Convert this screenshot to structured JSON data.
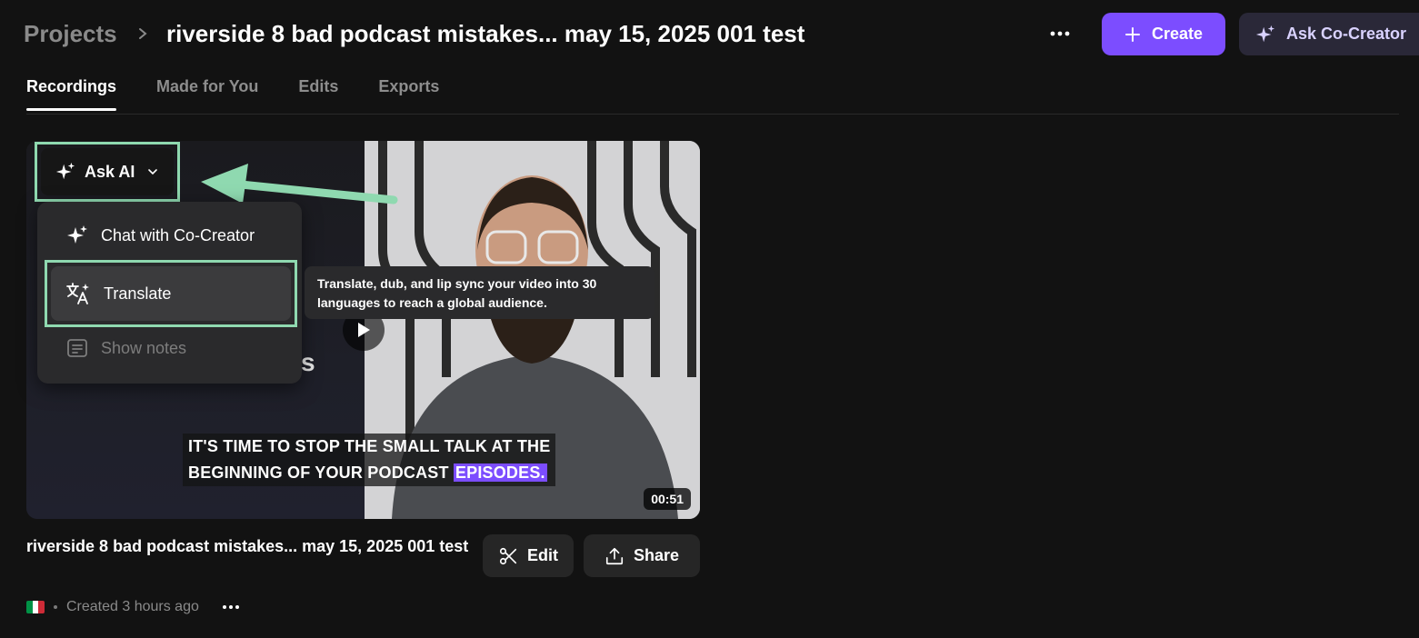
{
  "header": {
    "breadcrumb_root": "Projects",
    "project_title": "riverside 8 bad podcast mistakes... may 15, 2025 001 test",
    "create_label": "Create",
    "cocreator_label": "Ask Co-Creator"
  },
  "tabs": [
    {
      "label": "Recordings",
      "active": true
    },
    {
      "label": "Made for You",
      "active": false
    },
    {
      "label": "Edits",
      "active": false
    },
    {
      "label": "Exports",
      "active": false
    }
  ],
  "ask_ai": {
    "label": "Ask AI",
    "menu": [
      {
        "label": "Chat with Co-Creator",
        "icon": "sparkle-icon",
        "enabled": true
      },
      {
        "label": "Translate",
        "icon": "translate-icon",
        "enabled": true,
        "highlighted": true
      },
      {
        "label": "Show notes",
        "icon": "notes-icon",
        "enabled": false
      }
    ],
    "tooltip": "Translate, dub, and lip sync your video into 30 languages to reach a global audience."
  },
  "recording": {
    "caption_line1": "IT'S TIME TO STOP THE SMALL TALK AT THE",
    "caption_line2": "BEGINNING OF YOUR PODCAST",
    "caption_highlight": "EPISODES.",
    "duration": "00:51",
    "title": "riverside 8 bad podcast mistakes... may 15, 2025 001 test",
    "edit_label": "Edit",
    "share_label": "Share",
    "created": "Created 3 hours ago"
  },
  "colors": {
    "accent": "#7c4dff",
    "annotation": "#8fd9b0",
    "background": "#121212"
  }
}
